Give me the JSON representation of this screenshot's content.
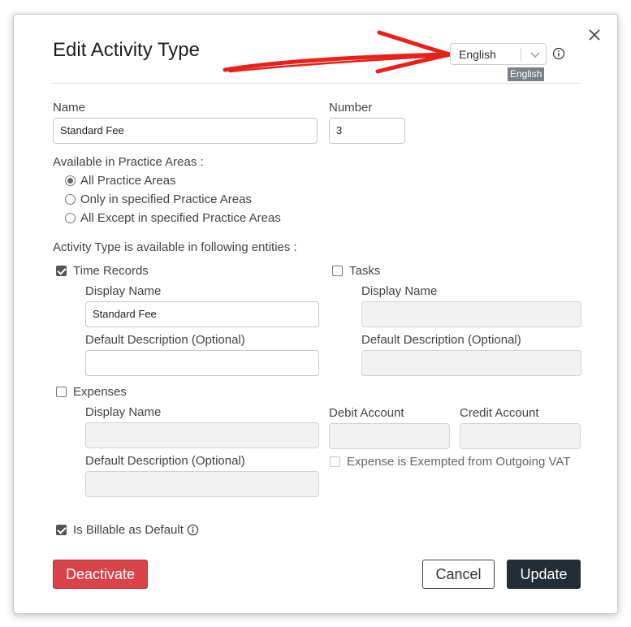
{
  "dialog": {
    "title": "Edit Activity Type",
    "close_symbol": "×"
  },
  "language": {
    "selected": "English",
    "tooltip": "English"
  },
  "name": {
    "label": "Name",
    "value": "Standard Fee"
  },
  "number": {
    "label": "Number",
    "value": "3"
  },
  "practice_areas": {
    "label": "Available in Practice Areas :",
    "options": [
      {
        "label": "All Practice Areas",
        "selected": true
      },
      {
        "label": "Only in specified Practice Areas",
        "selected": false
      },
      {
        "label": "All Except in specified Practice Areas",
        "selected": false
      }
    ]
  },
  "entities": {
    "label": "Activity Type is available in following entities :",
    "time_records": {
      "label": "Time Records",
      "checked": true,
      "display_name_label": "Display Name",
      "display_name_value": "Standard Fee",
      "default_desc_label": "Default Description (Optional)",
      "default_desc_value": ""
    },
    "tasks": {
      "label": "Tasks",
      "checked": false,
      "display_name_label": "Display Name",
      "default_desc_label": "Default Description (Optional)"
    },
    "expenses": {
      "label": "Expenses",
      "checked": false,
      "display_name_label": "Display Name",
      "default_desc_label": "Default Description (Optional)",
      "debit_account_label": "Debit Account",
      "credit_account_label": "Credit Account",
      "vat_exempt_label": "Expense is Exempted from Outgoing VAT",
      "vat_exempt_checked": false
    }
  },
  "billable": {
    "label": "Is Billable as Default",
    "checked": true
  },
  "buttons": {
    "deactivate": "Deactivate",
    "cancel": "Cancel",
    "update": "Update"
  },
  "colors": {
    "danger": "#d9434a",
    "primary": "#222d35",
    "annotation_arrow": "#e8201a"
  },
  "icons": {
    "close": "close-icon",
    "dropdown": "chevron-down-icon",
    "info": "info-icon",
    "annotation": "red-arrow-annotation"
  }
}
